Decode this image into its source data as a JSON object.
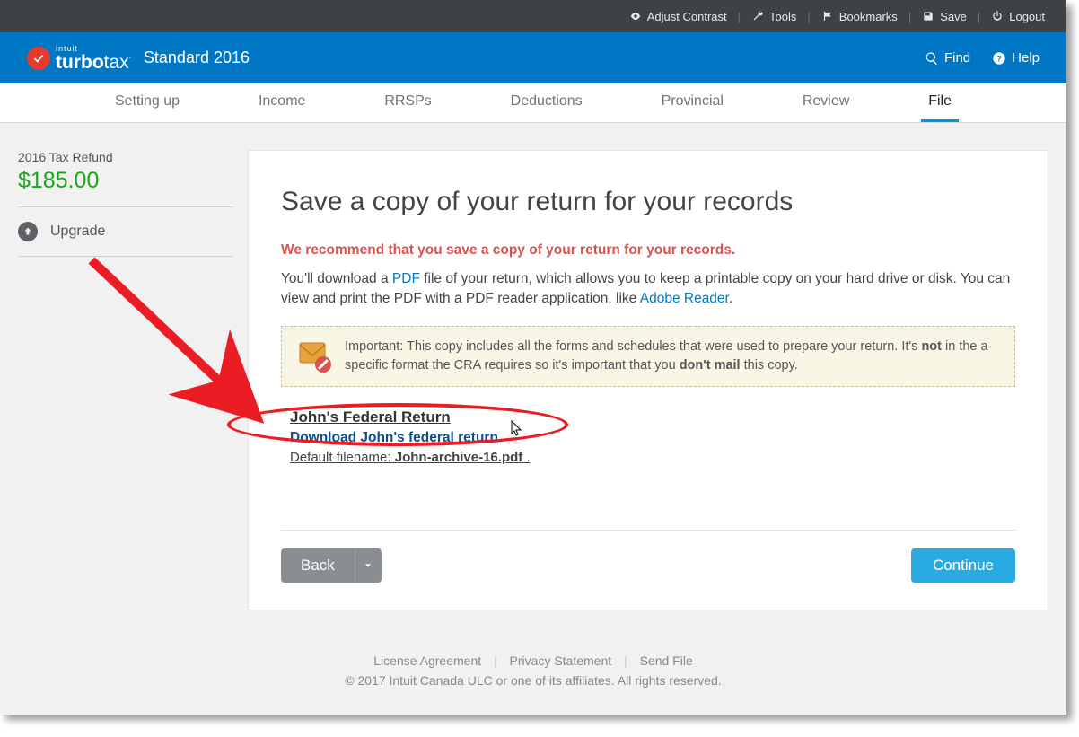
{
  "topbar": {
    "adjust_contrast": "Adjust Contrast",
    "tools": "Tools",
    "bookmarks": "Bookmarks",
    "save": "Save",
    "logout": "Logout"
  },
  "header": {
    "intuit": "intuit",
    "brand_bold": "turbo",
    "brand_light": "tax",
    "edition": "Standard 2016",
    "find": "Find",
    "help": "Help"
  },
  "tabs": [
    "Setting up",
    "Income",
    "RRSPs",
    "Deductions",
    "Provincial",
    "Review",
    "File"
  ],
  "active_tab": "File",
  "sidebar": {
    "refund_label": "2016 Tax Refund",
    "refund_amount": "$185.00",
    "upgrade": "Upgrade"
  },
  "card": {
    "title": "Save a copy of your return for your records",
    "recommend": "We recommend that you save a copy of your return for your records.",
    "para_pre": "You'll download a ",
    "para_pdf": "PDF",
    "para_mid": " file of your return, which allows you to keep a printable copy on your hard drive or disk. You can view and print the PDF with a PDF reader application, like ",
    "para_adobe": "Adobe Reader",
    "para_end": ".",
    "important_pre": "Important: This copy includes all the forms and schedules that were used to prepare your return. It's ",
    "important_not": "not",
    "important_mid": " in the a specific format the CRA requires so it's important that you ",
    "important_dontmail": "don't mail",
    "important_end": " this copy.",
    "return_title": "John's Federal Return",
    "download_link": "Download John's federal return",
    "default_filename_pre": "Default filename: ",
    "default_filename_bold": "John-archive-16.pdf",
    "default_filename_end": " .",
    "back": "Back",
    "continue": "Continue"
  },
  "footer": {
    "license": "License Agreement",
    "privacy": "Privacy Statement",
    "sendfile": "Send File",
    "copy": "© 2017 Intuit Canada ULC or one of its affiliates. All rights reserved."
  }
}
